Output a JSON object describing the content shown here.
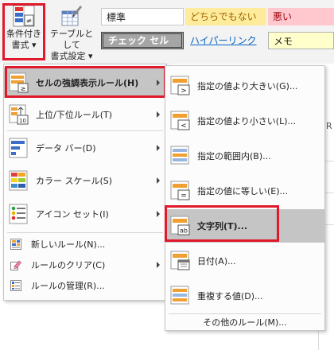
{
  "ribbon": {
    "conditional_formatting": {
      "line1": "条件付き",
      "line2": "書式 ▾"
    },
    "format_as_table": {
      "line1": "テーブルとして",
      "line2": "書式設定 ▾"
    },
    "styles": [
      {
        "label": "標準",
        "style": "normal"
      },
      {
        "label": "どちらでもない",
        "style": "neutral",
        "color": "#9c6500",
        "bg": "#ffeb9c"
      },
      {
        "label": "悪い",
        "style": "bad",
        "color": "#9c0006",
        "bg": "#ffc7ce"
      },
      {
        "label": "チェック セル",
        "style": "check",
        "color": "#ffffff",
        "bg": "#a5a5a5"
      },
      {
        "label": "ハイパーリンク",
        "style": "hyperlink",
        "color": "#0563c1"
      },
      {
        "label": "メモ",
        "style": "note",
        "bg": "#ffffcc"
      }
    ]
  },
  "sheet": {
    "column_fragment": "R"
  },
  "main_menu": {
    "items": [
      {
        "label": "セルの強調表示ルール(H)",
        "icon": "highlight-cells-rules-icon",
        "has_submenu": true,
        "selected": true
      },
      {
        "label": "上位/下位ルール(T)",
        "icon": "top-bottom-rules-icon",
        "has_submenu": true
      },
      {
        "label": "データ バー(D)",
        "icon": "data-bars-icon",
        "has_submenu": true
      },
      {
        "label": "カラー スケール(S)",
        "icon": "color-scales-icon",
        "has_submenu": true
      },
      {
        "label": "アイコン セット(I)",
        "icon": "icon-sets-icon",
        "has_submenu": true
      }
    ],
    "footer_items": [
      {
        "label": "新しいルール(N)...",
        "icon": "new-rule-icon",
        "has_submenu": false
      },
      {
        "label": "ルールのクリア(C)",
        "icon": "clear-rules-icon",
        "has_submenu": true
      },
      {
        "label": "ルールの管理(R)...",
        "icon": "manage-rules-icon",
        "has_submenu": false
      }
    ]
  },
  "sub_menu": {
    "items": [
      {
        "label": "指定の値より大きい(G)...",
        "icon": "greater-than-icon",
        "symbol": ">"
      },
      {
        "label": "指定の値より小さい(L)...",
        "icon": "less-than-icon",
        "symbol": "<"
      },
      {
        "label": "指定の範囲内(B)...",
        "icon": "between-icon",
        "symbol": ""
      },
      {
        "label": "指定の値に等しい(E)...",
        "icon": "equal-to-icon",
        "symbol": "="
      },
      {
        "label": "文字列(T)...",
        "icon": "text-contains-icon",
        "symbol": "ab",
        "selected": true
      },
      {
        "label": "日付(A)...",
        "icon": "date-occurring-icon",
        "symbol": ""
      },
      {
        "label": "重複する値(D)...",
        "icon": "duplicate-values-icon",
        "symbol": ""
      }
    ],
    "footer": "その他のルール(M)..."
  },
  "colors": {
    "highlight_border": "#e0192b",
    "selection_bg": "#c5c5c5",
    "cf_orange": "#f0a030",
    "cf_blue": "#3c6ec8"
  }
}
